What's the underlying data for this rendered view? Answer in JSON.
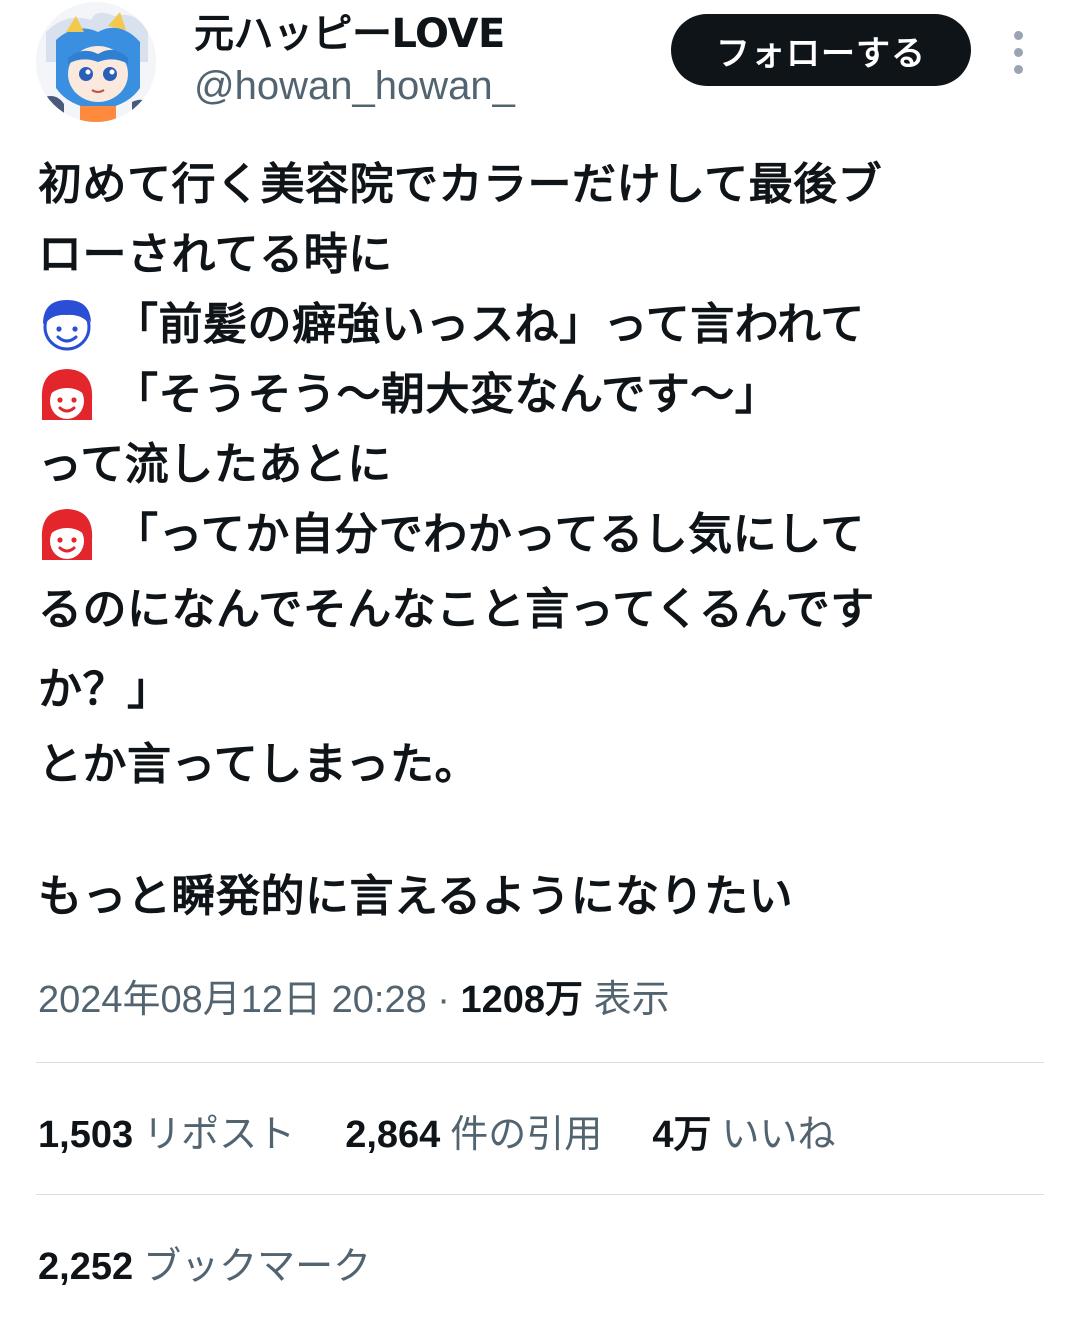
{
  "author": {
    "display_name": "元ハッピーLOVE",
    "handle": "@howan_howan_"
  },
  "actions": {
    "follow_label": "フォローする",
    "more_icon": "more-vertical-icon"
  },
  "tweet": {
    "lines": [
      "初めて行く美容院でカラーだけして最後ブ",
      "ローされてる時に",
      "「前髪の癖強いっスね」って言われて",
      "「そうそう〜朝大変なんです〜」",
      "って流したあとに",
      "「ってか自分でわかってるし気にして",
      "るのになんでそんなこと言ってくるんです",
      "か？」",
      "とか言ってしまった。",
      "",
      "もっと瞬発的に言えるようになりたい"
    ],
    "emoji": {
      "man_face": "man-face-icon",
      "woman_face": "woman-face-icon"
    }
  },
  "meta": {
    "timestamp": "2024年08月12日 20:28 · ",
    "views_count": "1208万",
    "views_label": "表示"
  },
  "stats": {
    "reposts_count": "1,503",
    "reposts_label": "リポスト",
    "quotes_count": "2,864",
    "quotes_label": "件の引用",
    "likes_count": "4万",
    "likes_label": "いいね",
    "bookmarks_count": "2,252",
    "bookmarks_label": "ブックマーク"
  },
  "colors": {
    "text": "#0f1419",
    "secondary": "#536471",
    "divider": "#d7dee3",
    "button_bg": "#0f1419",
    "man_face": "#2a4fd6",
    "woman_face": "#e3262c"
  }
}
